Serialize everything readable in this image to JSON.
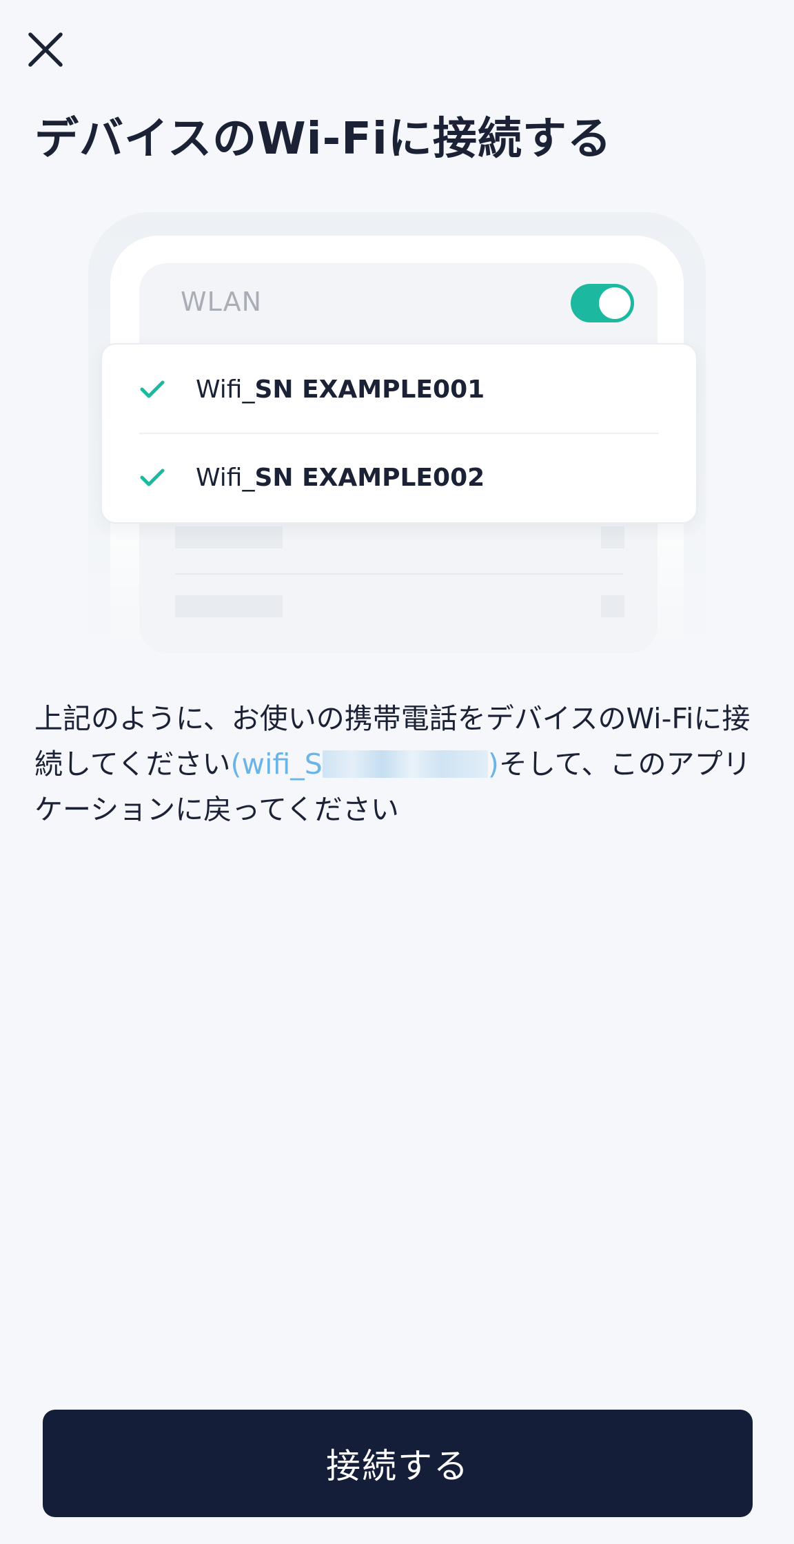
{
  "header": {
    "title": "デバイスのWi-Fiに接続する"
  },
  "illustration": {
    "wlan_label": "WLAN",
    "wlan_enabled": true,
    "networks": [
      {
        "prefix": "Wifi_",
        "name": "SN EXAMPLE001",
        "selected": true
      },
      {
        "prefix": "Wifi_",
        "name": "SN EXAMPLE002",
        "selected": true
      }
    ]
  },
  "instruction": {
    "text_before": "上記のように、お使いの携帯電話をデバイスのWi-Fiに接続してください",
    "ssid_visible": "(wifi_S",
    "ssid_close": ")",
    "text_after": "そして、このアプリケーションに戻ってください"
  },
  "footer": {
    "connect_label": "接続する"
  },
  "colors": {
    "accent_teal": "#1cb8a0",
    "primary_navy": "#141e38",
    "link_blue": "#6ab4e6",
    "background": "#f5f7fa"
  },
  "icons": {
    "close": "close-icon",
    "check": "check-icon"
  }
}
